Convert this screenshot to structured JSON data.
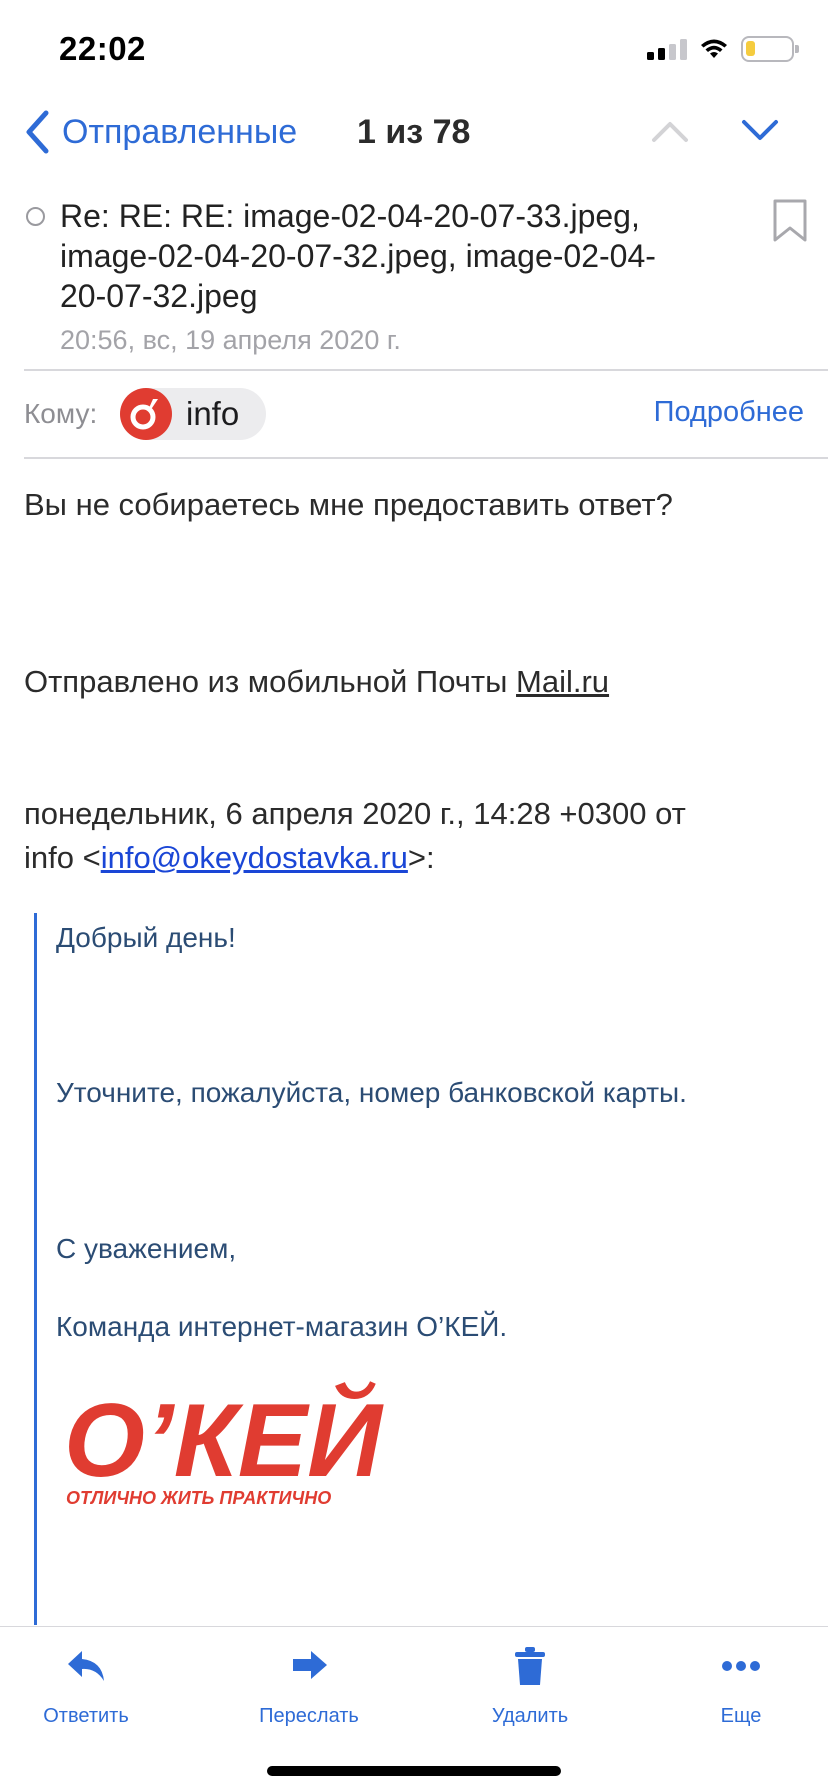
{
  "status_bar": {
    "time": "22:02"
  },
  "nav": {
    "back_label": "Отправленные",
    "counter": "1 из 78"
  },
  "message": {
    "subject": "Re: RE: RE: image-02-04-20-07-33.jpeg, image-02-04-20-07-32.jpeg, image-02-04-20-07-32.jpeg",
    "date": "20:56, вс, 19 апреля 2020 г.",
    "to_label": "Кому:",
    "recipient_name": "info",
    "details_label": "Подробнее"
  },
  "body": {
    "question": "Вы не собираетесь мне предоставить ответ?",
    "sent_from_prefix": "Отправлено из мобильной Почты ",
    "sent_from_link": "Mail.ru",
    "quote_header_line1": "понедельник, 6 апреля 2020 г., 14:28 +0300 от",
    "quote_header_name": "info <",
    "quote_header_email": "info@okeydostavka.ru",
    "quote_header_suffix": ">:",
    "quote_greeting": "Добрый день!",
    "quote_request": "Уточните, пожалуйста, номер банковской карты.",
    "quote_regards": "С уважением,",
    "quote_signature": "Команда интернет-магазин О’КЕЙ.",
    "logo_text": "О’КЕЙ",
    "logo_slogan": "ОТЛИЧНО ЖИТЬ ПРАКТИЧНО"
  },
  "toolbar": {
    "reply_label": "Ответить",
    "forward_label": "Переслать",
    "delete_label": "Удалить",
    "more_label": "Еще"
  },
  "colors": {
    "accent": "#2e6bd6",
    "quote_text": "#2b4c74",
    "brand_red": "#e03c31"
  }
}
